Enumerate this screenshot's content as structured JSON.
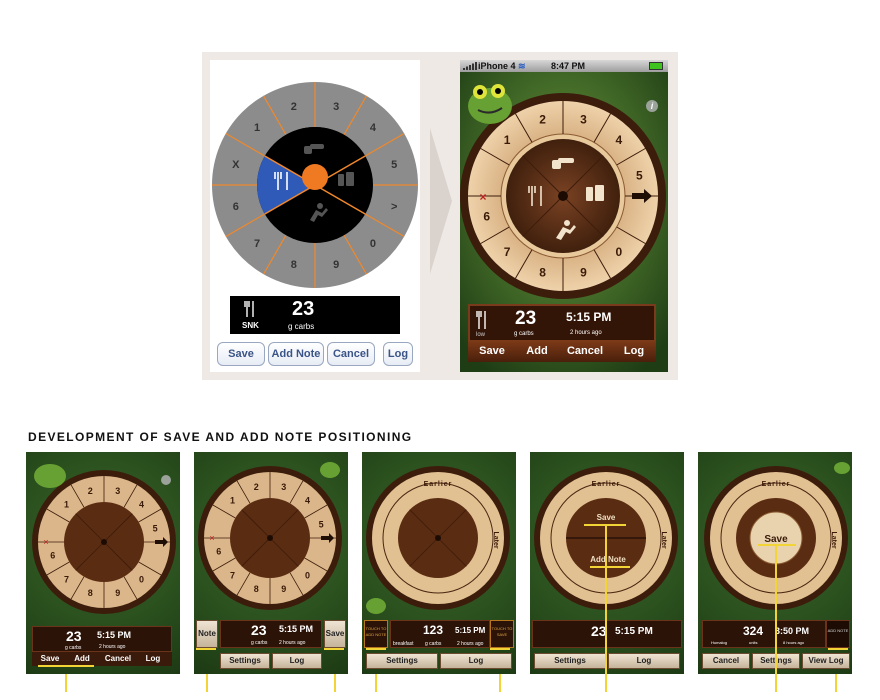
{
  "wireframe": {
    "wheel_numbers": [
      "1",
      "2",
      "3",
      "4",
      "5",
      ">",
      "0",
      "9",
      "8",
      "7",
      "6",
      "X"
    ],
    "readout": {
      "category": "SNK",
      "value": "23",
      "unit": "g carbs"
    },
    "buttons": [
      "Save",
      "Add Note",
      "Cancel",
      "Log"
    ]
  },
  "phone": {
    "status": {
      "carrier": "iPhone 4",
      "time": "8:47 PM"
    },
    "info_label": "i",
    "readout": {
      "category": "low",
      "value": "23",
      "unit": "g carbs",
      "time": "5:15 PM",
      "ago": "2 hours ago"
    },
    "buttons": [
      "Save",
      "Add",
      "Cancel",
      "Log"
    ]
  },
  "section_title": "DEVELOPMENT OF SAVE AND ADD NOTE POSITIONING",
  "thumbs": [
    {
      "value": "23",
      "unit": "g carbs",
      "time": "5:15 PM",
      "ago": "2 hours ago",
      "buttons": [
        "Save",
        "Add",
        "Cancel",
        "Log"
      ]
    },
    {
      "note_label": "Note",
      "save_label": "Save",
      "value": "23",
      "unit": "g carbs",
      "time": "5:15 PM",
      "ago": "2 hours ago",
      "buttons": [
        "Settings",
        "Log"
      ]
    },
    {
      "ring_top": "Earlier",
      "ring_side": "Later",
      "left_box": "TOUCH TO ADD NOTE",
      "category": "breakfast",
      "value": "123",
      "unit": "g carbs",
      "time": "5:15 PM",
      "ago": "2 hours ago",
      "right_box": "TOUCH TO SAVE",
      "buttons": [
        "Settings",
        "Log"
      ]
    },
    {
      "ring_top": "Earlier",
      "ring_side": "Later",
      "center_top": "Save",
      "center_bottom": "Add Note",
      "value": "23",
      "time": "5:15 PM",
      "buttons": [
        "Settings",
        "Log"
      ]
    },
    {
      "ring_top": "Earlier",
      "ring_side": "Later",
      "center": "Save",
      "category": "Humalog",
      "value": "324",
      "unit": "units",
      "time": "3:50 PM",
      "ago": "8 hours ago",
      "add_note": "ADD NOTE",
      "buttons": [
        "Cancel",
        "Settings",
        "View Log"
      ]
    }
  ],
  "colors": {
    "panel_bg": "#efe9e6",
    "wire_ring": "#8c8c8c",
    "wire_spoke": "#f0882b",
    "wire_selected": "#2f5ab8",
    "wire_hub": "#f07a22",
    "wood_light": "#e2c197",
    "wood_dark": "#4f2713",
    "highlight_line": "#f3d437",
    "button_text": "#3a5487"
  },
  "icons": [
    "fork-knife-icon",
    "pointing-hand-icon",
    "medicine-icon",
    "runner-icon",
    "arrow-right-icon",
    "x-icon",
    "info-icon",
    "wifi-icon",
    "battery-icon",
    "frog-icon"
  ]
}
